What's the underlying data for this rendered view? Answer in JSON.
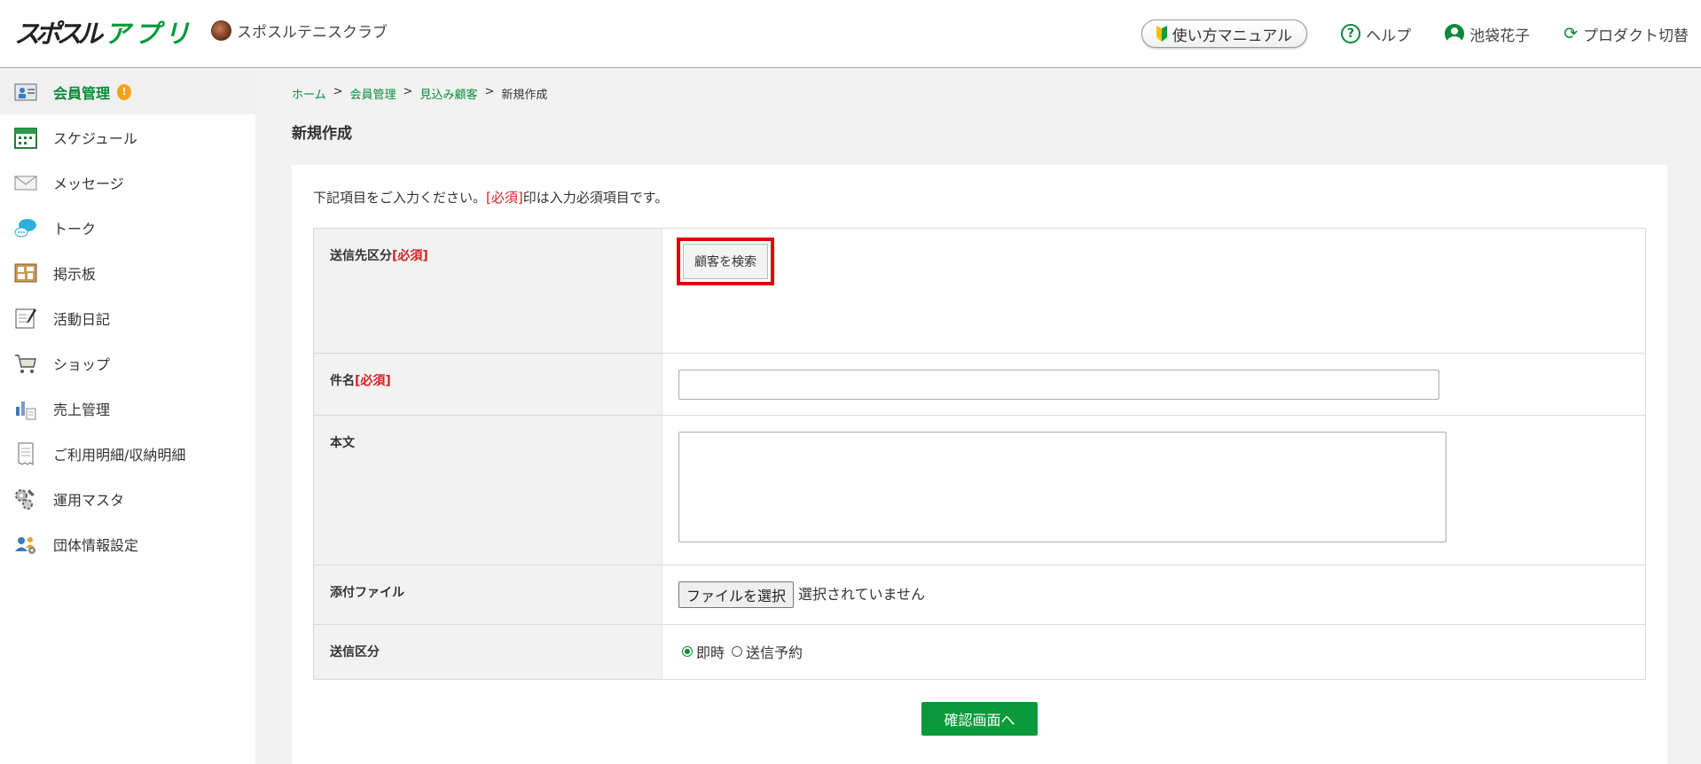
{
  "header": {
    "logo_text": "スポスルアプリ",
    "club_name": "スポスルテニスクラブ",
    "manual_label": "使い方マニュアル",
    "help_label": "ヘルプ",
    "user_name": "池袋花子",
    "product_switch_label": "プロダクト切替"
  },
  "sidebar": {
    "items": [
      {
        "label": "会員管理",
        "icon": "member-icon",
        "active": true,
        "badge": "!"
      },
      {
        "label": "スケジュール",
        "icon": "calendar-icon"
      },
      {
        "label": "メッセージ",
        "icon": "envelope-icon"
      },
      {
        "label": "トーク",
        "icon": "chat-bubble-icon"
      },
      {
        "label": "掲示板",
        "icon": "bulletin-board-icon"
      },
      {
        "label": "活動日記",
        "icon": "diary-icon"
      },
      {
        "label": "ショップ",
        "icon": "cart-icon"
      },
      {
        "label": "売上管理",
        "icon": "sales-chart-icon"
      },
      {
        "label": "ご利用明細/収納明細",
        "icon": "receipt-icon"
      },
      {
        "label": "運用マスタ",
        "icon": "gear-wrench-icon"
      },
      {
        "label": "団体情報設定",
        "icon": "group-settings-icon"
      }
    ]
  },
  "breadcrumb": {
    "home": "ホーム",
    "member": "会員管理",
    "prospect": "見込み顧客",
    "current": "新規作成",
    "sep": ">"
  },
  "page": {
    "title": "新規作成",
    "intro_before": "下記項目をご入力ください。",
    "intro_required": "[必須]",
    "intro_after": "印は入力必須項目です。"
  },
  "form": {
    "required_mark": "[必須]",
    "recipient_label": "送信先区分",
    "search_button": "顧客を検索",
    "subject_label": "件名",
    "subject_value": "",
    "body_label": "本文",
    "body_value": "",
    "attachment_label": "添付ファイル",
    "file_button": "ファイルを選択",
    "file_status": "選択されていません",
    "send_type_label": "送信区分",
    "send_options": [
      "即時",
      "送信予約"
    ],
    "send_selected": "即時"
  },
  "actions": {
    "confirm_button": "確認画面へ"
  },
  "colors": {
    "accent": "#0a8a3a",
    "required": "#d52222",
    "highlight": "#e00000",
    "badge": "#f4a21b"
  }
}
